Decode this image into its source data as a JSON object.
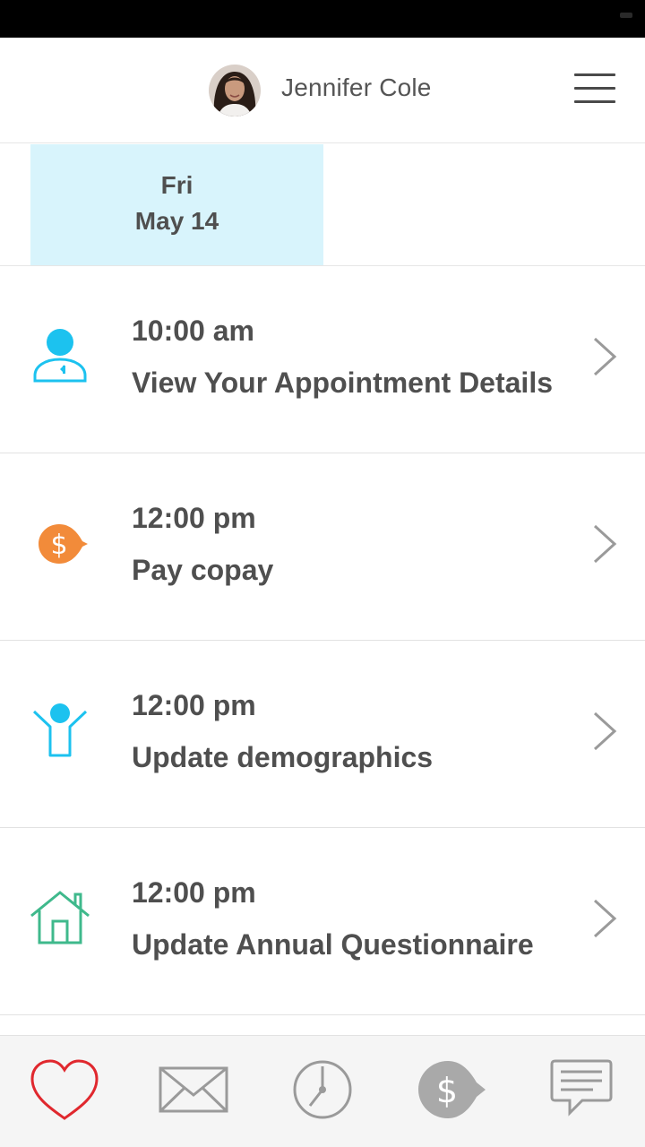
{
  "header": {
    "user_name": "Jennifer Cole"
  },
  "date_tabs": [
    {
      "day": "Fri",
      "date": "May 14",
      "selected": true
    }
  ],
  "tasks": [
    {
      "time": "10:00 am",
      "label": "View Your Appointment Details",
      "icon": "doctor-icon"
    },
    {
      "time": "12:00 pm",
      "label": "Pay copay",
      "icon": "dollar-tag-icon"
    },
    {
      "time": "12:00 pm",
      "label": "Update demographics",
      "icon": "person-arms-up-icon"
    },
    {
      "time": "12:00 pm",
      "label": "Update Annual Questionnaire",
      "icon": "house-icon"
    }
  ],
  "tab_bar": [
    {
      "icon": "heart-icon",
      "active": true
    },
    {
      "icon": "mail-icon",
      "active": false
    },
    {
      "icon": "clock-icon",
      "active": false
    },
    {
      "icon": "dollar-tag-icon",
      "active": false
    },
    {
      "icon": "chat-icon",
      "active": false
    }
  ],
  "colors": {
    "accent_blue": "#1cc2ef",
    "selected_date_bg": "#d8f4fc",
    "copay_orange": "#f28b3a",
    "house_green": "#3fb98c",
    "heart_red": "#e0282e",
    "inactive_gray": "#9a9a9a"
  }
}
